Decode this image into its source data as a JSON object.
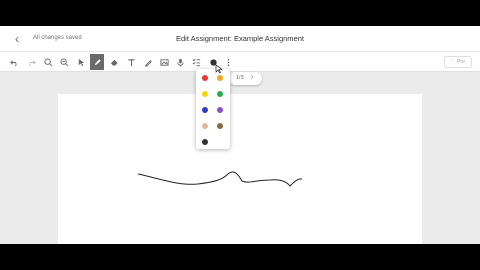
{
  "header": {
    "back_icon": "chevron-left-icon",
    "save_status": "All changes saved",
    "title": "Edit Assignment: Example Assignment"
  },
  "toolbar": {
    "tools": [
      "undo-icon",
      "redo-icon",
      "zoom-in-icon",
      "zoom-out-icon",
      "select-icon",
      "pen-icon",
      "eraser-icon",
      "text-icon",
      "highlighter-icon",
      "image-icon",
      "audio-icon",
      "checklist-icon",
      "color-icon",
      "more-icon"
    ],
    "active_tool": "pen-icon",
    "pro_label": "Pro"
  },
  "pager": {
    "label": "1/3"
  },
  "palette": {
    "colors": [
      "#e53935",
      "#f5a623",
      "#f4d60f",
      "#2fa84f",
      "#2e3fbf",
      "#8b4fc9",
      "#e0b7a0",
      "#8a6a3f",
      "#333333"
    ]
  },
  "bottom_toolbar": {
    "tools": [
      "pause-icon",
      "pointer-icon",
      "pen-icon",
      "eraser-icon",
      "page-icon",
      "camera-icon",
      "close-icon"
    ]
  }
}
